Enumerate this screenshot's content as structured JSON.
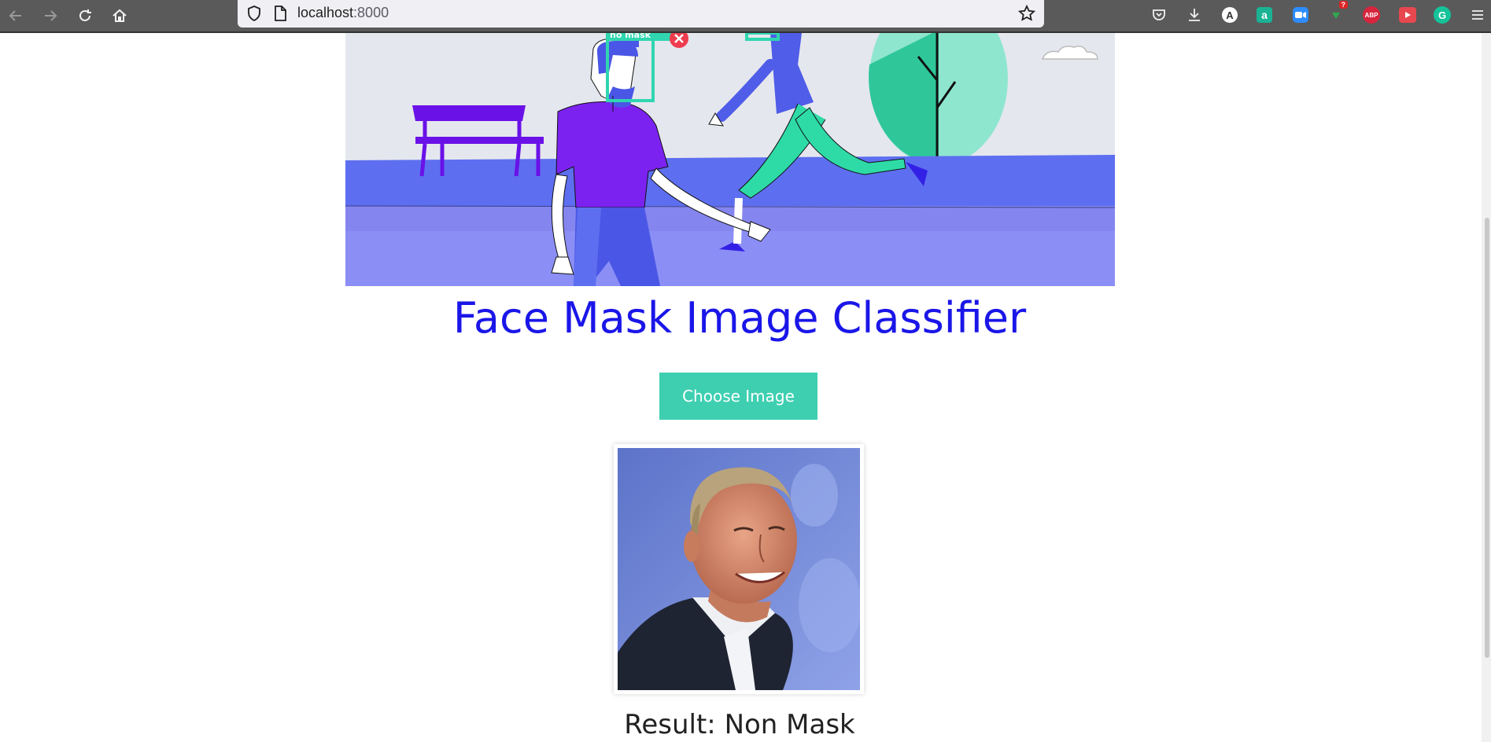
{
  "browser": {
    "url_host": "localhost",
    "url_port": ":8000",
    "extensions": [
      {
        "name": "pocket-icon",
        "label": ""
      },
      {
        "name": "download-icon",
        "label": ""
      },
      {
        "name": "a-extension-icon",
        "label": "A"
      },
      {
        "name": "amazon-icon",
        "label": "a"
      },
      {
        "name": "zoom-icon",
        "label": ""
      },
      {
        "name": "download-helper-icon",
        "label": "?"
      },
      {
        "name": "adblock-icon",
        "label": "ABP"
      },
      {
        "name": "video-icon",
        "label": ""
      },
      {
        "name": "grammarly-icon",
        "label": "G"
      }
    ]
  },
  "hero": {
    "detection_label": "no mask"
  },
  "page": {
    "title": "Face Mask Image Classifier",
    "choose_button": "Choose Image",
    "result_text": "Result: Non Mask"
  },
  "colors": {
    "title": "#1a16e8",
    "button": "#3ecfb1",
    "hero_ground": "#5d6ff0",
    "hero_path": "#8b8ef5",
    "detection_box": "#2fd6b0"
  }
}
